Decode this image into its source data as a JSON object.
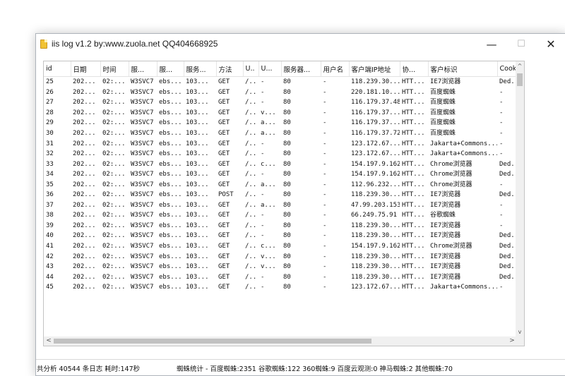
{
  "window": {
    "title": "iis log v1.2 by:www.zuola.net QQ404668925",
    "minimize_glyph": "—",
    "maximize_glyph": "☐",
    "close_glyph": "✕",
    "icon": "document-icon"
  },
  "table": {
    "columns": [
      "id",
      "日期",
      "时间",
      "服...",
      "服...",
      "服务...",
      "方法",
      "U..",
      "U...",
      "服务器...",
      "用户名",
      "客户端IP地址",
      "协...",
      "客户标识",
      "Cookie"
    ],
    "rows": [
      [
        "25",
        "202...",
        "02:...",
        "W3SVC7",
        "ebs...",
        "103...",
        "GET",
        "/..",
        "-",
        "80",
        "-",
        "118.239.30...",
        "HTT...",
        "IE7浏览器",
        "Ded..."
      ],
      [
        "26",
        "202...",
        "02:...",
        "W3SVC7",
        "ebs...",
        "103...",
        "GET",
        "/..",
        "-",
        "80",
        "-",
        "220.181.10...",
        "HTT...",
        "百度蜘蛛",
        "-"
      ],
      [
        "27",
        "202...",
        "02:...",
        "W3SVC7",
        "ebs...",
        "103...",
        "GET",
        "/..",
        "-",
        "80",
        "-",
        "116.179.37.48",
        "HTT...",
        "百度蜘蛛",
        "-"
      ],
      [
        "28",
        "202...",
        "02:...",
        "W3SVC7",
        "ebs...",
        "103...",
        "GET",
        "/..",
        "v...",
        "80",
        "-",
        "116.179.37...",
        "HTT...",
        "百度蜘蛛",
        "-"
      ],
      [
        "29",
        "202...",
        "02:...",
        "W3SVC7",
        "ebs...",
        "103...",
        "GET",
        "/..",
        "a...",
        "80",
        "-",
        "116.179.37...",
        "HTT...",
        "百度蜘蛛",
        "-"
      ],
      [
        "30",
        "202...",
        "02:...",
        "W3SVC7",
        "ebs...",
        "103...",
        "GET",
        "/..",
        "a...",
        "80",
        "-",
        "116.179.37.72",
        "HTT...",
        "百度蜘蛛",
        "-"
      ],
      [
        "31",
        "202...",
        "02:...",
        "W3SVC7",
        "ebs...",
        "103...",
        "GET",
        "/..",
        "-",
        "80",
        "-",
        "123.172.67...",
        "HTT...",
        "Jakarta+Commons...",
        "-"
      ],
      [
        "32",
        "202...",
        "02:...",
        "W3SVC7",
        "ebs...",
        "103...",
        "GET",
        "/..",
        "-",
        "80",
        "-",
        "123.172.67...",
        "HTT...",
        "Jakarta+Commons...",
        "-"
      ],
      [
        "33",
        "202...",
        "02:...",
        "W3SVC7",
        "ebs...",
        "103...",
        "GET",
        "/..",
        "c...",
        "80",
        "-",
        "154.197.9.162",
        "HTT...",
        "Chrome浏览器",
        "Ded..."
      ],
      [
        "34",
        "202...",
        "02:...",
        "W3SVC7",
        "ebs...",
        "103...",
        "GET",
        "/..",
        "-",
        "80",
        "-",
        "154.197.9.162",
        "HTT...",
        "Chrome浏览器",
        "Ded..."
      ],
      [
        "35",
        "202...",
        "02:...",
        "W3SVC7",
        "ebs...",
        "103...",
        "GET",
        "/..",
        "a...",
        "80",
        "-",
        "112.96.232...",
        "HTT...",
        "Chrome浏览器",
        "-"
      ],
      [
        "36",
        "202...",
        "02:...",
        "W3SVC7",
        "ebs...",
        "103...",
        "POST",
        "/..",
        "-",
        "80",
        "-",
        "118.239.30...",
        "HTT...",
        "IE7浏览器",
        "Ded..."
      ],
      [
        "37",
        "202...",
        "02:...",
        "W3SVC7",
        "ebs...",
        "103...",
        "GET",
        "/..",
        "a...",
        "80",
        "-",
        "47.99.203.153",
        "HTT...",
        "IE7浏览器",
        "-"
      ],
      [
        "38",
        "202...",
        "02:...",
        "W3SVC7",
        "ebs...",
        "103...",
        "GET",
        "/..",
        "-",
        "80",
        "-",
        "66.249.75.91",
        "HTT...",
        "谷歌蜘蛛",
        "-"
      ],
      [
        "39",
        "202...",
        "02:...",
        "W3SVC7",
        "ebs...",
        "103...",
        "GET",
        "/..",
        "-",
        "80",
        "-",
        "118.239.30...",
        "HTT...",
        "IE7浏览器",
        "-"
      ],
      [
        "40",
        "202...",
        "02:...",
        "W3SVC7",
        "ebs...",
        "103...",
        "GET",
        "/..",
        "-",
        "80",
        "-",
        "118.239.30...",
        "HTT...",
        "IE7浏览器",
        "Ded..."
      ],
      [
        "41",
        "202...",
        "02:...",
        "W3SVC7",
        "ebs...",
        "103...",
        "GET",
        "/..",
        "c...",
        "80",
        "-",
        "154.197.9.162",
        "HTT...",
        "Chrome浏览器",
        "Ded..."
      ],
      [
        "42",
        "202...",
        "02:...",
        "W3SVC7",
        "ebs...",
        "103...",
        "GET",
        "/..",
        "v...",
        "80",
        "-",
        "118.239.30...",
        "HTT...",
        "IE7浏览器",
        "Ded..."
      ],
      [
        "43",
        "202...",
        "02:...",
        "W3SVC7",
        "ebs...",
        "103...",
        "GET",
        "/..",
        "v...",
        "80",
        "-",
        "118.239.30...",
        "HTT...",
        "IE7浏览器",
        "Ded..."
      ],
      [
        "44",
        "202...",
        "02:...",
        "W3SVC7",
        "ebs...",
        "103...",
        "GET",
        "/..",
        "-",
        "80",
        "-",
        "118.239.30...",
        "HTT...",
        "IE7浏览器",
        "Ded..."
      ],
      [
        "45",
        "202...",
        "02:...",
        "W3SVC7",
        "ebs...",
        "103...",
        "GET",
        "/..",
        "-",
        "80",
        "-",
        "123.172.67...",
        "HTT...",
        "Jakarta+Commons...",
        "-"
      ]
    ]
  },
  "scrollbars": {
    "up_glyph": "^",
    "down_glyph": "v",
    "left_glyph": "<",
    "right_glyph": ">"
  },
  "status": {
    "summary": "共分析 40544 条日志  耗时:147秒",
    "spider_stats": "蜘蛛统计 - 百度蜘蛛:2351 谷歌蜘蛛:122 360蜘蛛:9 百度云观测:0 神马蜘蛛:2 其他蜘蛛:70"
  }
}
